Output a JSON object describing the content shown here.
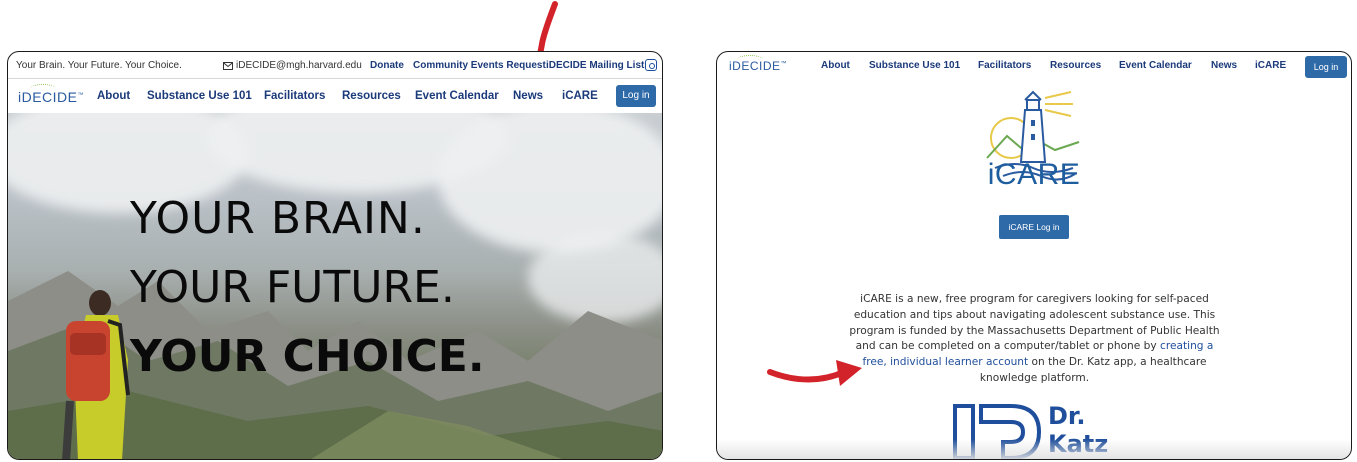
{
  "left": {
    "topbar": {
      "tagline": "Your Brain. Your Future. Your Choice.",
      "email": "iDECIDE@mgh.harvard.edu",
      "donate": "Donate",
      "community": "Community Events Request",
      "mailing": "iDECIDE Mailing List",
      "instagram_icon": "instagram-icon"
    },
    "logo": "iDECIDE",
    "nav": [
      "About",
      "Substance Use 101",
      "Facilitators",
      "Resources",
      "Event Calendar",
      "News",
      "iCARE"
    ],
    "login": "Log in",
    "hero": {
      "line1": "YOUR BRAIN.",
      "line2": "YOUR FUTURE.",
      "line3": "YOUR CHOICE."
    }
  },
  "right": {
    "logo": "iDECIDE",
    "nav": [
      "About",
      "Substance Use 101",
      "Facilitators",
      "Resources",
      "Event Calendar",
      "News",
      "iCARE"
    ],
    "login": "Log in",
    "icare_title": "iCARE",
    "icare_button": "iCARE Log in",
    "paragraph_before": "iCARE is a new, free program for caregivers looking for self-paced education and tips about navigating adolescent substance use. This program is funded by the Massachusetts Department of Public Health and can be completed on a computer/tablet or phone by ",
    "paragraph_link": "creating a free, individual learner account",
    "paragraph_after": " on the Dr. Katz app, a healthcare knowledge platform.",
    "katz_line1": "Dr.",
    "katz_line2": "Katz"
  },
  "colors": {
    "nav_text": "#1b3a7a",
    "button": "#2f6aa8",
    "icare_blue": "#1f5e9e",
    "arrow_red": "#d3232a"
  }
}
